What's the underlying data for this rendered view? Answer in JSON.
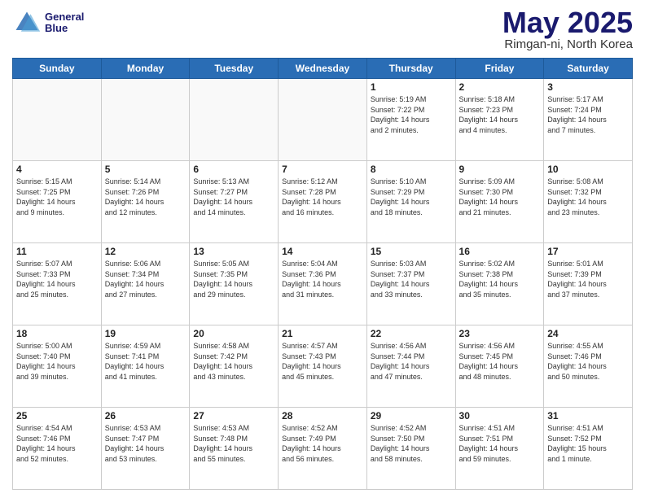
{
  "header": {
    "logo_line1": "General",
    "logo_line2": "Blue",
    "month": "May 2025",
    "location": "Rimgan-ni, North Korea"
  },
  "days_of_week": [
    "Sunday",
    "Monday",
    "Tuesday",
    "Wednesday",
    "Thursday",
    "Friday",
    "Saturday"
  ],
  "weeks": [
    [
      {
        "day": "",
        "info": ""
      },
      {
        "day": "",
        "info": ""
      },
      {
        "day": "",
        "info": ""
      },
      {
        "day": "",
        "info": ""
      },
      {
        "day": "1",
        "info": "Sunrise: 5:19 AM\nSunset: 7:22 PM\nDaylight: 14 hours\nand 2 minutes."
      },
      {
        "day": "2",
        "info": "Sunrise: 5:18 AM\nSunset: 7:23 PM\nDaylight: 14 hours\nand 4 minutes."
      },
      {
        "day": "3",
        "info": "Sunrise: 5:17 AM\nSunset: 7:24 PM\nDaylight: 14 hours\nand 7 minutes."
      }
    ],
    [
      {
        "day": "4",
        "info": "Sunrise: 5:15 AM\nSunset: 7:25 PM\nDaylight: 14 hours\nand 9 minutes."
      },
      {
        "day": "5",
        "info": "Sunrise: 5:14 AM\nSunset: 7:26 PM\nDaylight: 14 hours\nand 12 minutes."
      },
      {
        "day": "6",
        "info": "Sunrise: 5:13 AM\nSunset: 7:27 PM\nDaylight: 14 hours\nand 14 minutes."
      },
      {
        "day": "7",
        "info": "Sunrise: 5:12 AM\nSunset: 7:28 PM\nDaylight: 14 hours\nand 16 minutes."
      },
      {
        "day": "8",
        "info": "Sunrise: 5:10 AM\nSunset: 7:29 PM\nDaylight: 14 hours\nand 18 minutes."
      },
      {
        "day": "9",
        "info": "Sunrise: 5:09 AM\nSunset: 7:30 PM\nDaylight: 14 hours\nand 21 minutes."
      },
      {
        "day": "10",
        "info": "Sunrise: 5:08 AM\nSunset: 7:32 PM\nDaylight: 14 hours\nand 23 minutes."
      }
    ],
    [
      {
        "day": "11",
        "info": "Sunrise: 5:07 AM\nSunset: 7:33 PM\nDaylight: 14 hours\nand 25 minutes."
      },
      {
        "day": "12",
        "info": "Sunrise: 5:06 AM\nSunset: 7:34 PM\nDaylight: 14 hours\nand 27 minutes."
      },
      {
        "day": "13",
        "info": "Sunrise: 5:05 AM\nSunset: 7:35 PM\nDaylight: 14 hours\nand 29 minutes."
      },
      {
        "day": "14",
        "info": "Sunrise: 5:04 AM\nSunset: 7:36 PM\nDaylight: 14 hours\nand 31 minutes."
      },
      {
        "day": "15",
        "info": "Sunrise: 5:03 AM\nSunset: 7:37 PM\nDaylight: 14 hours\nand 33 minutes."
      },
      {
        "day": "16",
        "info": "Sunrise: 5:02 AM\nSunset: 7:38 PM\nDaylight: 14 hours\nand 35 minutes."
      },
      {
        "day": "17",
        "info": "Sunrise: 5:01 AM\nSunset: 7:39 PM\nDaylight: 14 hours\nand 37 minutes."
      }
    ],
    [
      {
        "day": "18",
        "info": "Sunrise: 5:00 AM\nSunset: 7:40 PM\nDaylight: 14 hours\nand 39 minutes."
      },
      {
        "day": "19",
        "info": "Sunrise: 4:59 AM\nSunset: 7:41 PM\nDaylight: 14 hours\nand 41 minutes."
      },
      {
        "day": "20",
        "info": "Sunrise: 4:58 AM\nSunset: 7:42 PM\nDaylight: 14 hours\nand 43 minutes."
      },
      {
        "day": "21",
        "info": "Sunrise: 4:57 AM\nSunset: 7:43 PM\nDaylight: 14 hours\nand 45 minutes."
      },
      {
        "day": "22",
        "info": "Sunrise: 4:56 AM\nSunset: 7:44 PM\nDaylight: 14 hours\nand 47 minutes."
      },
      {
        "day": "23",
        "info": "Sunrise: 4:56 AM\nSunset: 7:45 PM\nDaylight: 14 hours\nand 48 minutes."
      },
      {
        "day": "24",
        "info": "Sunrise: 4:55 AM\nSunset: 7:46 PM\nDaylight: 14 hours\nand 50 minutes."
      }
    ],
    [
      {
        "day": "25",
        "info": "Sunrise: 4:54 AM\nSunset: 7:46 PM\nDaylight: 14 hours\nand 52 minutes."
      },
      {
        "day": "26",
        "info": "Sunrise: 4:53 AM\nSunset: 7:47 PM\nDaylight: 14 hours\nand 53 minutes."
      },
      {
        "day": "27",
        "info": "Sunrise: 4:53 AM\nSunset: 7:48 PM\nDaylight: 14 hours\nand 55 minutes."
      },
      {
        "day": "28",
        "info": "Sunrise: 4:52 AM\nSunset: 7:49 PM\nDaylight: 14 hours\nand 56 minutes."
      },
      {
        "day": "29",
        "info": "Sunrise: 4:52 AM\nSunset: 7:50 PM\nDaylight: 14 hours\nand 58 minutes."
      },
      {
        "day": "30",
        "info": "Sunrise: 4:51 AM\nSunset: 7:51 PM\nDaylight: 14 hours\nand 59 minutes."
      },
      {
        "day": "31",
        "info": "Sunrise: 4:51 AM\nSunset: 7:52 PM\nDaylight: 15 hours\nand 1 minute."
      }
    ]
  ]
}
